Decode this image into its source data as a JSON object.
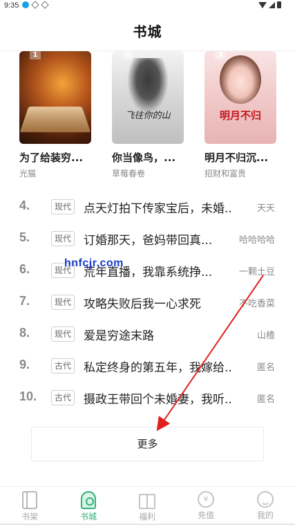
{
  "status_bar": {
    "time": "9:35"
  },
  "header": {
    "title": "书城"
  },
  "top_books": [
    {
      "rank": "1",
      "title": "为了给装穷...",
      "author": "光猫",
      "cover_text": ""
    },
    {
      "rank": "2",
      "title": "你当像鸟，...",
      "author": "草莓春卷",
      "cover_text": "飞往你的山"
    },
    {
      "rank": "3",
      "title": "明月不归沉...",
      "author": "招财和富贵",
      "cover_text": "明月不归"
    }
  ],
  "rank_list": [
    {
      "num": "4.",
      "genre": "现代",
      "title": "点天灯拍下传家宝后，未婚...",
      "author": "天天"
    },
    {
      "num": "5.",
      "genre": "现代",
      "title": "订婚那天，爸妈带回真...",
      "author": "哈哈哈哈"
    },
    {
      "num": "6.",
      "genre": "现代",
      "title": "荒年直播，我靠系统挣...",
      "author": "一颗土豆"
    },
    {
      "num": "7.",
      "genre": "现代",
      "title": "攻略失败后我一心求死",
      "author": "不吃香菜"
    },
    {
      "num": "8.",
      "genre": "现代",
      "title": "爱是穷途末路",
      "author": "山楂"
    },
    {
      "num": "9.",
      "genre": "古代",
      "title": "私定终身的第五年，我嫁给...",
      "author": "匿名"
    },
    {
      "num": "10.",
      "genre": "古代",
      "title": "摄政王带回个未婚妻，我听...",
      "author": "匿名"
    }
  ],
  "more_button": {
    "label": "更多"
  },
  "watermark": {
    "text": "hnfcjr.com"
  },
  "tab_bar": {
    "items": [
      {
        "label": "书架",
        "icon": "bookshelf-icon"
      },
      {
        "label": "书城",
        "icon": "bookstore-icon"
      },
      {
        "label": "福利",
        "icon": "gift-icon"
      },
      {
        "label": "充值",
        "icon": "recharge-icon",
        "glyph": "¥"
      },
      {
        "label": "我的",
        "icon": "profile-icon"
      }
    ],
    "active_color": "#33b07a",
    "inactive_color": "#a8a8a8"
  },
  "accent_colors": {
    "arrow": "#e02020",
    "watermark": "#1a3cc8"
  }
}
